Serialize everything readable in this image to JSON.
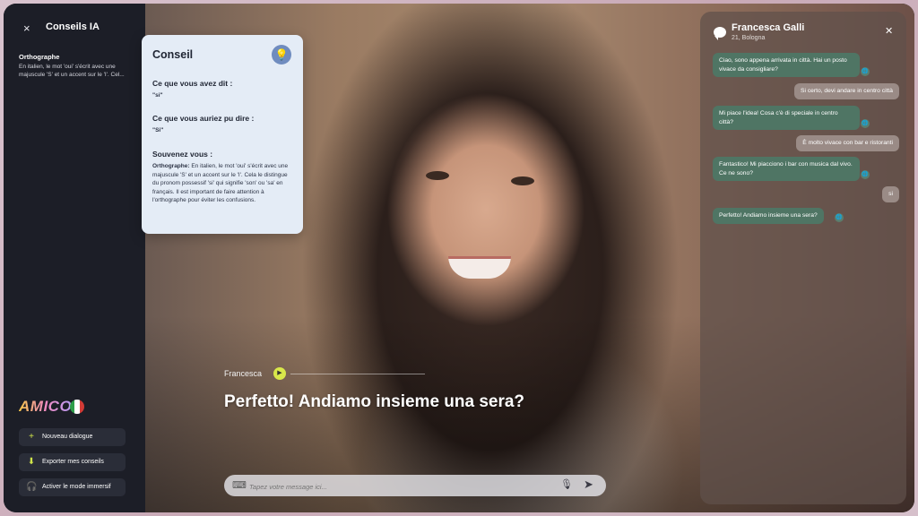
{
  "sidebar": {
    "close_glyph": "×",
    "title": "Conseils IA",
    "item_title": "Orthographe",
    "item_text": "En italien, le mot 'oui' s'écrit avec une majuscule 'S' et un accent sur le 'I'. Cel...",
    "brand": "AMICO",
    "buttons": {
      "new_dialogue": "Nouveau dialogue",
      "export": "Exporter mes conseils",
      "immersive": "Activer le mode immersif"
    },
    "flag_colors": [
      "#2e9e4a",
      "#ffffff",
      "#d23b36"
    ]
  },
  "conseil": {
    "title": "Conseil",
    "said_heading": "Ce que vous avez dit :",
    "said_value": "\"si\"",
    "could_heading": "Ce que vous auriez pu dire :",
    "could_value": "\"Si\"",
    "remember_heading": "Souvenez vous :",
    "body_label": "Orthographe:",
    "body_text": " En italien, le mot 'oui' s'écrit avec une majuscule 'S' et un accent sur le 'I'. Cela le distingue du pronom possessif 'si' qui signifie 'son' ou 'sa' en français. Il est important de faire attention à l'orthographe pour éviter les confusions."
  },
  "speaker": {
    "name": "Francesca"
  },
  "subtitle": "Perfetto! Andiamo insieme una sera?",
  "message_input": {
    "placeholder": "Tapez votre message ici..."
  },
  "chat": {
    "name": "Francesca Galli",
    "sub": "21, Bologna",
    "messages": [
      {
        "from": "bot",
        "text": "Ciao, sono appena arrivata in città. Hai un posto vivace da consigliare?"
      },
      {
        "from": "user",
        "text": "Si certo, devi andare in centro città"
      },
      {
        "from": "bot",
        "text": "Mi piace l'idea! Cosa c'è di speciale in centro città?"
      },
      {
        "from": "user",
        "text": "È molto vivace con bar e ristoranti"
      },
      {
        "from": "bot",
        "text": "Fantastico! Mi piacciono i bar con musica dal vivo. Ce ne sono?"
      },
      {
        "from": "user",
        "text": "si"
      },
      {
        "from": "bot",
        "text": "Perfetto! Andiamo insieme una sera?"
      }
    ]
  },
  "colors": {
    "accent_yellow": "#d9e84a",
    "bot_bubble": "#4f7564",
    "user_bubble": "#9a8b86"
  }
}
